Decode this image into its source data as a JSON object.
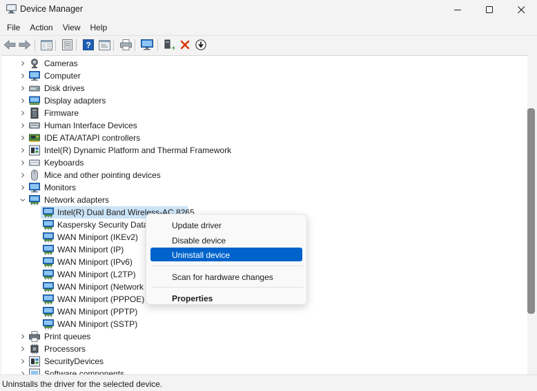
{
  "window": {
    "title": "Device Manager"
  },
  "menu": [
    "File",
    "Action",
    "View",
    "Help"
  ],
  "toolbar": [
    "back-icon",
    "forward-icon",
    "tree-view-icon",
    "properties-sheet-icon",
    "help-icon",
    "console-icon",
    "print-icon",
    "monitor-icon",
    "update-driver-icon",
    "uninstall-icon",
    "download-icon"
  ],
  "tree": [
    {
      "label": "Cameras",
      "expanded": false,
      "icon": "camera-icon"
    },
    {
      "label": "Computer",
      "expanded": false,
      "icon": "computer-icon"
    },
    {
      "label": "Disk drives",
      "expanded": false,
      "icon": "disk-drive-icon"
    },
    {
      "label": "Display adapters",
      "expanded": false,
      "icon": "display-adapter-icon"
    },
    {
      "label": "Firmware",
      "expanded": false,
      "icon": "firmware-icon"
    },
    {
      "label": "Human Interface Devices",
      "expanded": false,
      "icon": "hid-icon"
    },
    {
      "label": "IDE ATA/ATAPI controllers",
      "expanded": false,
      "icon": "ide-controller-icon"
    },
    {
      "label": "Intel(R) Dynamic Platform and Thermal Framework",
      "expanded": false,
      "icon": "chip-icon"
    },
    {
      "label": "Keyboards",
      "expanded": false,
      "icon": "keyboard-icon"
    },
    {
      "label": "Mice and other pointing devices",
      "expanded": false,
      "icon": "mouse-icon"
    },
    {
      "label": "Monitors",
      "expanded": false,
      "icon": "monitor-icon"
    },
    {
      "label": "Network adapters",
      "expanded": true,
      "icon": "network-adapter-icon"
    }
  ],
  "network_children": [
    "Intel(R) Dual Band Wireless-AC 8265",
    "Kaspersky Security Data",
    "WAN Miniport (IKEv2)",
    "WAN Miniport (IP)",
    "WAN Miniport (IPv6)",
    "WAN Miniport (L2TP)",
    "WAN Miniport (Network",
    "WAN Miniport (PPPOE)",
    "WAN Miniport (PPTP)",
    "WAN Miniport (SSTP)"
  ],
  "tree_after": [
    {
      "label": "Print queues",
      "icon": "printer-icon"
    },
    {
      "label": "Processors",
      "icon": "processor-icon"
    },
    {
      "label": "SecurityDevices",
      "icon": "security-device-icon"
    },
    {
      "label": "Software components",
      "icon": "software-component-icon"
    }
  ],
  "context_menu": {
    "update_driver": "Update driver",
    "disable_device": "Disable device",
    "uninstall_device": "Uninstall device",
    "scan_hardware": "Scan for hardware changes",
    "properties": "Properties"
  },
  "status": "Uninstalls the driver for the selected device.",
  "colors": {
    "selection": "#cce4f7",
    "menu_highlight": "#0063cc",
    "delete_red": "#d83b01"
  }
}
